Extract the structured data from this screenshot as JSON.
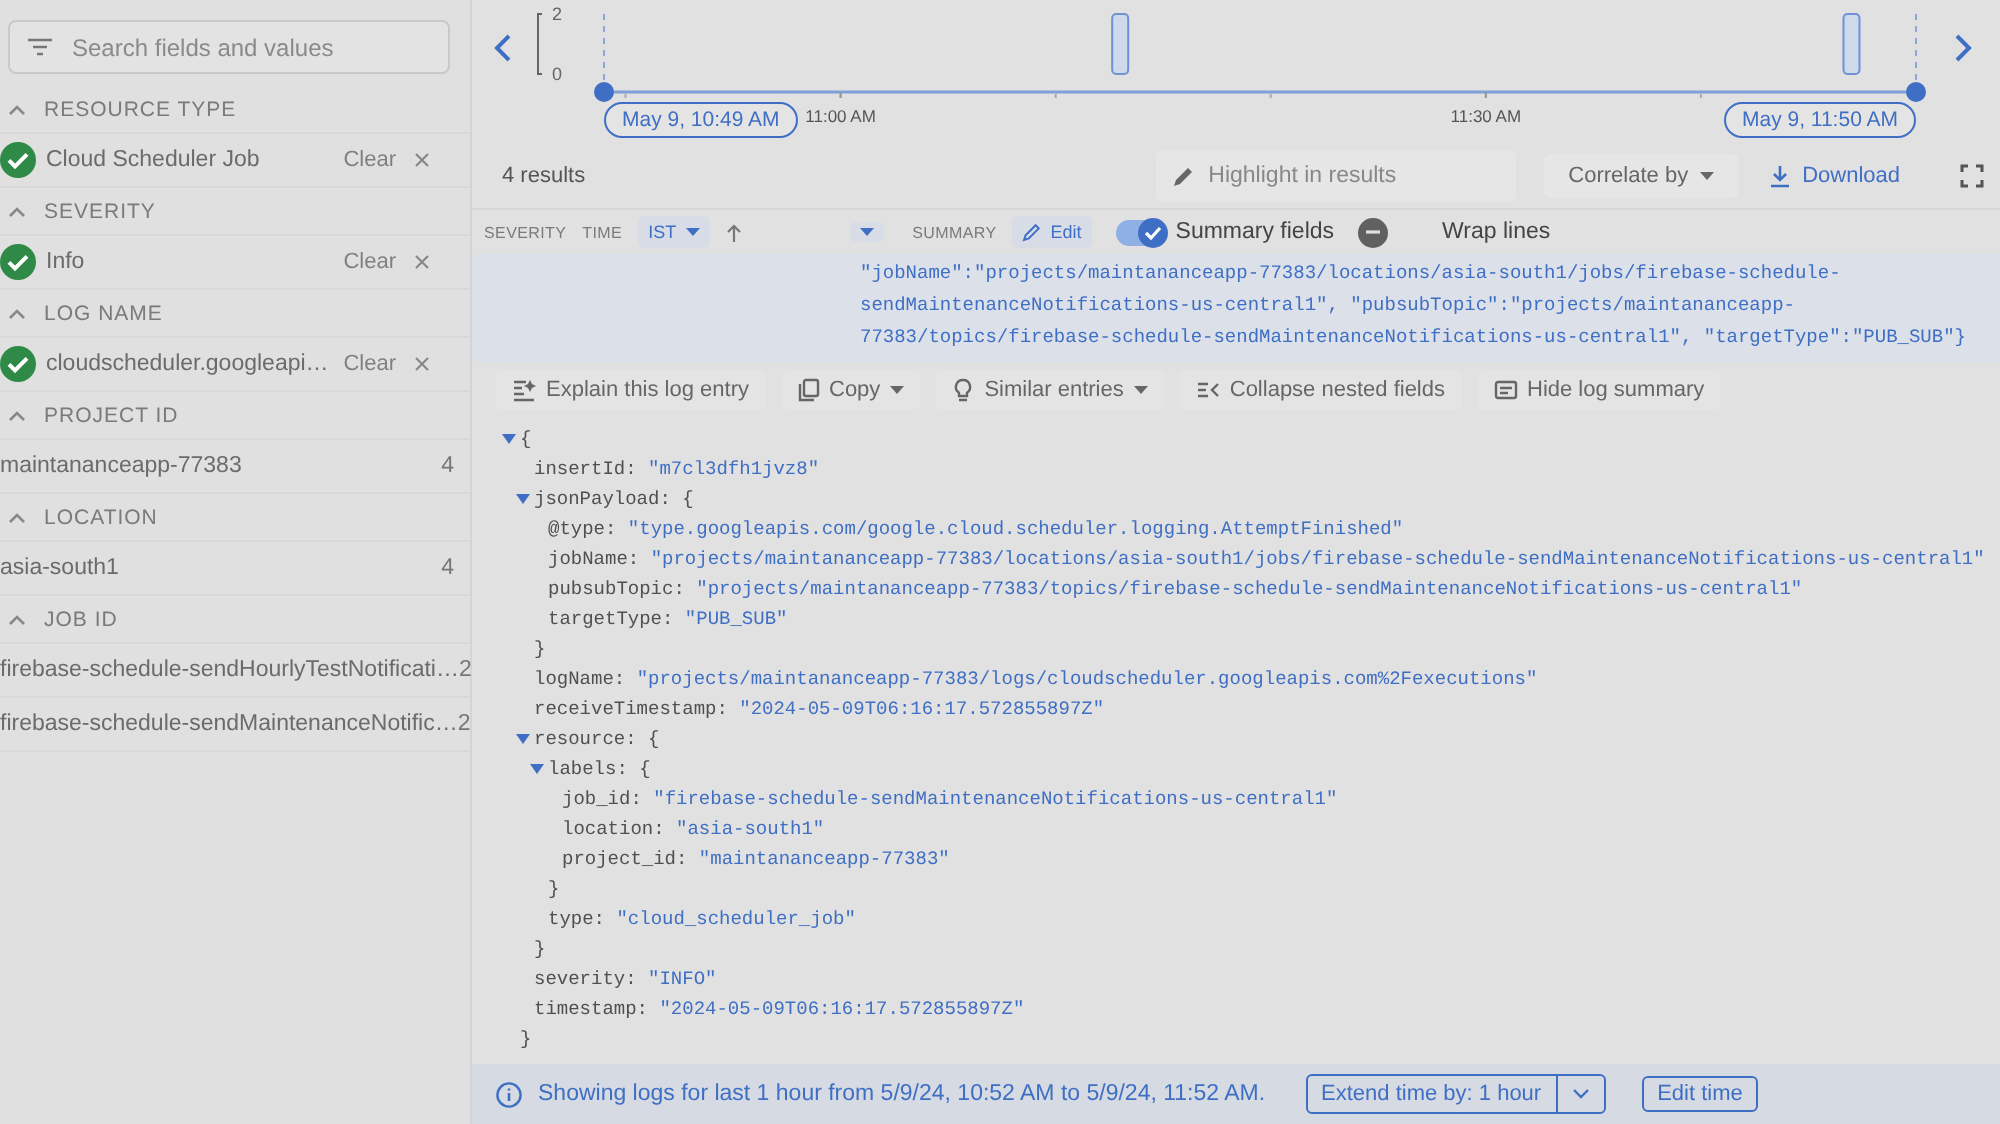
{
  "sidebar": {
    "search": {
      "placeholder": "Search fields and values"
    },
    "sections": [
      {
        "title": "RESOURCE TYPE",
        "expanded": true,
        "items": [
          {
            "kind": "filter",
            "label": "Cloud Scheduler Job",
            "checked": true,
            "action": "Clear"
          }
        ]
      },
      {
        "title": "SEVERITY",
        "expanded": true,
        "items": [
          {
            "kind": "filter",
            "label": "Info",
            "checked": true,
            "action": "Clear"
          }
        ]
      },
      {
        "title": "LOG NAME",
        "expanded": true,
        "items": [
          {
            "kind": "filter",
            "label": "cloudscheduler.googleapi…",
            "checked": true,
            "action": "Clear"
          }
        ]
      },
      {
        "title": "PROJECT ID",
        "expanded": true,
        "items": [
          {
            "kind": "value",
            "label": "maintananceapp-77383",
            "count": "4"
          }
        ]
      },
      {
        "title": "LOCATION",
        "expanded": true,
        "items": [
          {
            "kind": "value",
            "label": "asia-south1",
            "count": "4"
          }
        ]
      },
      {
        "title": "JOB ID",
        "expanded": true,
        "items": [
          {
            "kind": "value",
            "label": "firebase-schedule-sendHourlyTestNotificati…",
            "count": "2"
          },
          {
            "kind": "value",
            "label": "firebase-schedule-sendMaintenanceNotific…",
            "count": "2"
          }
        ]
      }
    ]
  },
  "timeline": {
    "start": "May 9, 10:49 AM",
    "end": "May 9, 11:50 AM",
    "chart_data": {
      "type": "bar",
      "x": [
        673,
        707
      ],
      "values": [
        2,
        2
      ],
      "xlim": [
        649,
        710
      ],
      "ylim": [
        0,
        2
      ],
      "yticks": [
        0,
        2
      ],
      "xticks": [
        {
          "value": 660,
          "label": "11:00 AM"
        },
        {
          "value": 690,
          "label": "11:30 AM"
        }
      ]
    }
  },
  "toolbar": {
    "results": "4 results",
    "highlight": {
      "placeholder": "Highlight in results"
    },
    "correlate": "Correlate by",
    "download": "Download"
  },
  "columns": {
    "severity": "SEVERITY",
    "time": "TIME",
    "timezone": "IST",
    "summary": "SUMMARY",
    "edit": "Edit",
    "toggles": [
      {
        "label": "Summary fields",
        "on": true
      },
      {
        "label": "Wrap lines",
        "on": false
      }
    ]
  },
  "log_entry": {
    "summary": "\"jobName\":\"projects/maintananceapp-77383/locations/asia-south1/jobs/firebase-schedule-sendMaintenanceNotifications-us-central1\", \"pubsubTopic\":\"projects/maintananceapp-77383/topics/firebase-schedule-sendMaintenanceNotifications-us-central1\", \"targetType\":\"PUB_SUB\"}",
    "actions": [
      {
        "label": "Explain this log entry",
        "dropdown": false
      },
      {
        "label": "Copy",
        "dropdown": true
      },
      {
        "label": "Similar entries",
        "dropdown": true
      },
      {
        "label": "Collapse nested fields",
        "dropdown": false
      },
      {
        "label": "Hide log summary",
        "dropdown": false
      }
    ],
    "payload": {
      "open": "{",
      "expanded": true,
      "close": "}",
      "children": [
        {
          "key": "insertId:",
          "value": "\"m7cl3dfh1jvz8\""
        },
        {
          "key": "jsonPayload:",
          "open": "{",
          "expanded": true,
          "close": "}",
          "children": [
            {
              "key": "@type:",
              "value": "\"type.googleapis.com/google.cloud.scheduler.logging.AttemptFinished\""
            },
            {
              "key": "jobName:",
              "value": "\"projects/maintananceapp-77383/locations/asia-south1/jobs/firebase-schedule-sendMaintenanceNotifications-us-central1\""
            },
            {
              "key": "pubsubTopic:",
              "value": "\"projects/maintananceapp-77383/topics/firebase-schedule-sendMaintenanceNotifications-us-central1\""
            },
            {
              "key": "targetType:",
              "value": "\"PUB_SUB\""
            }
          ]
        },
        {
          "key": "logName:",
          "value": "\"projects/maintananceapp-77383/logs/cloudscheduler.googleapis.com%2Fexecutions\""
        },
        {
          "key": "receiveTimestamp:",
          "value": "\"2024-05-09T06:16:17.572855897Z\""
        },
        {
          "key": "resource:",
          "open": "{",
          "expanded": true,
          "close": "}",
          "children": [
            {
              "key": "labels:",
              "open": "{",
              "expanded": true,
              "close": "}",
              "children": [
                {
                  "key": "job_id:",
                  "value": "\"firebase-schedule-sendMaintenanceNotifications-us-central1\""
                },
                {
                  "key": "location:",
                  "value": "\"asia-south1\""
                },
                {
                  "key": "project_id:",
                  "value": "\"maintananceapp-77383\""
                }
              ]
            },
            {
              "key": "type:",
              "value": "\"cloud_scheduler_job\""
            }
          ]
        },
        {
          "key": "severity:",
          "value": "\"INFO\""
        },
        {
          "key": "timestamp:",
          "value": "\"2024-05-09T06:16:17.572855897Z\""
        }
      ]
    }
  },
  "footer": {
    "message": "Showing logs for last 1 hour from 5/9/24, 10:52 AM to 5/9/24, 11:52 AM.",
    "extend": "Extend time by: 1 hour",
    "edit": "Edit time"
  }
}
